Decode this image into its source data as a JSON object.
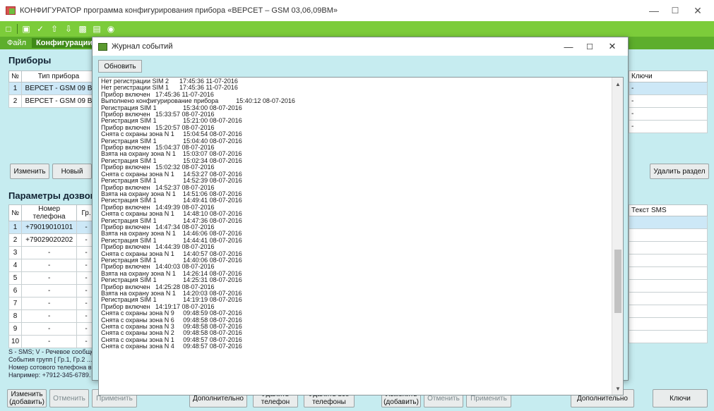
{
  "window": {
    "title": "КОНФИГУРАТОР программа конфигурирования прибора «ВЕРСЕТ – GSM 03,06,09ВМ»",
    "min_icon": "minimize-icon",
    "max_icon": "maximize-icon",
    "close_icon": "close-icon"
  },
  "menu": {
    "file": "Файл",
    "config": "Конфигурации"
  },
  "devices": {
    "title": "Приборы",
    "col_num": "№",
    "col_type": "Тип прибора",
    "col_keys": "Ключи",
    "rows": [
      {
        "num": "1",
        "type": "ВЕРСЕТ - GSM 09 В",
        "keys": "-"
      },
      {
        "num": "2",
        "type": "ВЕРСЕТ - GSM 09 В",
        "keys": "-"
      }
    ],
    "extra_keys": [
      "-",
      "-"
    ],
    "edit": "Изменить",
    "new": "Новый",
    "delete_section": "Удалить раздел"
  },
  "dialing": {
    "title": "Параметры дозвона",
    "col_num": "№",
    "col_phone": "Номер телефона",
    "col_group": "Гр.",
    "col_sms": "Текст SMS",
    "rows": [
      {
        "num": "1",
        "phone": "+79019010101",
        "g": "-"
      },
      {
        "num": "2",
        "phone": "+79029020202",
        "g": "-"
      },
      {
        "num": "3",
        "phone": "-",
        "g": "-"
      },
      {
        "num": "4",
        "phone": "-",
        "g": "-"
      },
      {
        "num": "5",
        "phone": "-",
        "g": "-"
      },
      {
        "num": "6",
        "phone": "-",
        "g": "-"
      },
      {
        "num": "7",
        "phone": "-",
        "g": "-"
      },
      {
        "num": "8",
        "phone": "-",
        "g": "-"
      },
      {
        "num": "9",
        "phone": "-",
        "g": "-"
      },
      {
        "num": "10",
        "phone": "-",
        "g": "-"
      }
    ],
    "note1": "S - SMS;  V - Речевое сообще",
    "note2": "События групп [ Гр.1, Гр.2 ...",
    "note3": "Номер сотового телефона вв",
    "note4": "Например: +7912-345-6789. Р"
  },
  "bottom_left": {
    "edit_add": "Изменить (добавить)",
    "cancel": "Отменить",
    "apply": "Применить",
    "more": "Дополнительно",
    "delete_phone": "Удалить телефон",
    "delete_all": "Удалить все телефоны"
  },
  "bottom_right": {
    "edit_add": "Изменить (добавить)",
    "cancel": "Отменить",
    "apply": "Применить",
    "more": "Дополнительно",
    "keys": "Ключи"
  },
  "dialog": {
    "title": "Журнал событий",
    "refresh": "Обновить",
    "lines": [
      "Нет регистрации SIM 2      17:45:36 11-07-2016",
      "Нет регистрации SIM 1      17:45:36 11-07-2016",
      "Прибор включен   17:45:36 11-07-2016",
      "Выполнено конфигурирование прибора          15:40:12 08-07-2016",
      "Регистрация SIM 1               15:34:00 08-07-2016",
      "Прибор включен   15:33:57 08-07-2016",
      "Регистрация SIM 1               15:21:00 08-07-2016",
      "Прибор включен   15:20:57 08-07-2016",
      "Снята с охраны зона N 1     15:04:54 08-07-2016",
      "Регистрация SIM 1               15:04:40 08-07-2016",
      "Прибор включен   15:04:37 08-07-2016",
      "Взята на охрану зона N 1    15:03:07 08-07-2016",
      "Регистрация SIM 1               15:02:34 08-07-2016",
      "Прибор включен   15:02:32 08-07-2016",
      "Снята с охраны зона N 1     14:53:27 08-07-2016",
      "Регистрация SIM 1               14:52:39 08-07-2016",
      "Прибор включен   14:52:37 08-07-2016",
      "Взята на охрану зона N 1    14:51:06 08-07-2016",
      "Регистрация SIM 1               14:49:41 08-07-2016",
      "Прибор включен   14:49:39 08-07-2016",
      "Снята с охраны зона N 1     14:48:10 08-07-2016",
      "Регистрация SIM 1               14:47:36 08-07-2016",
      "Прибор включен   14:47:34 08-07-2016",
      "Взята на охрану зона N 1    14:46:06 08-07-2016",
      "Регистрация SIM 1               14:44:41 08-07-2016",
      "Прибор включен   14:44:39 08-07-2016",
      "Снята с охраны зона N 1     14:40:57 08-07-2016",
      "Регистрация SIM 1               14:40:06 08-07-2016",
      "Прибор включен   14:40:03 08-07-2016",
      "Взята на охрану зона N 1    14:26:14 08-07-2016",
      "Регистрация SIM 1               14:25:31 08-07-2016",
      "Прибор включен   14:25:28 08-07-2016",
      "Взята на охрану зона N 1    14:20:03 08-07-2016",
      "Регистрация SIM 1               14:19:19 08-07-2016",
      "Прибор включен   14:19:17 08-07-2016",
      "Снята с охраны зона N 9     09:48:59 08-07-2016",
      "Снята с охраны зона N 6     09:48:58 08-07-2016",
      "Снята с охраны зона N 3     09:48:58 08-07-2016",
      "Снята с охраны зона N 2     09:48:58 08-07-2016",
      "Снята с охраны зона N 1     09:48:57 08-07-2016",
      "Снята с охраны зона N 4     09:48:57 08-07-2016"
    ]
  }
}
